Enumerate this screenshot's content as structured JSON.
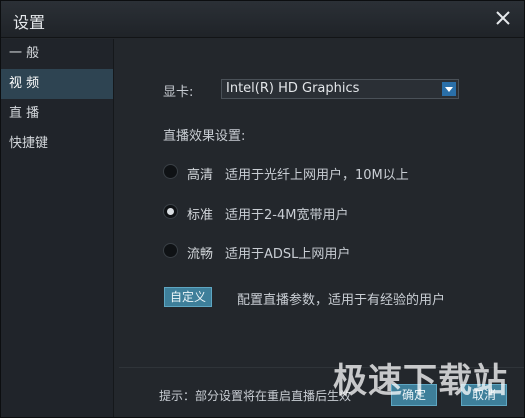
{
  "window": {
    "title": "设置"
  },
  "sidebar": {
    "items": [
      {
        "label": "一 般"
      },
      {
        "label": "视 频"
      },
      {
        "label": "直 播"
      },
      {
        "label": "快捷键"
      }
    ],
    "active_index": 1
  },
  "gpu": {
    "label": "显卡:",
    "selected": "Intel(R) HD Graphics"
  },
  "live_settings": {
    "section_label": "直播效果设置:",
    "options": [
      {
        "name": "高清",
        "desc": "适用于光纤上网用户，10M以上",
        "checked": false
      },
      {
        "name": "标准",
        "desc": "适用于2-4M宽带用户",
        "checked": true
      },
      {
        "name": "流畅",
        "desc": "适用于ADSL上网用户",
        "checked": false
      }
    ]
  },
  "custom": {
    "button_label": "自定义",
    "desc": "配置直播参数，适用于有经验的用户"
  },
  "footer": {
    "hint": "提示：部分设置将在重启直播后生效",
    "ok_label": "确定",
    "cancel_label": "取消"
  },
  "watermark": "极速下载站",
  "colors": {
    "accent": "#3e7f9a",
    "active_nav": "#2e4452",
    "dropdown_arrow": "#2a6fa8"
  }
}
